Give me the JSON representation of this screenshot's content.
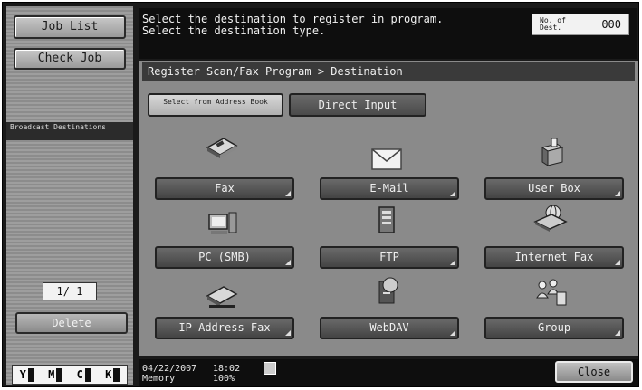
{
  "left_panel": {
    "job_list_label": "Job List",
    "check_job_label": "Check Job",
    "broadcast_label": "Broadcast Destinations",
    "page_indicator": "1/  1",
    "delete_label": "Delete",
    "toner": [
      {
        "letter": "Y"
      },
      {
        "letter": "M"
      },
      {
        "letter": "C"
      },
      {
        "letter": "K"
      }
    ]
  },
  "header": {
    "message_line1": "Select the destination to register in program.",
    "message_line2": "Select the destination type.",
    "dest_count_label": "No. of Dest.",
    "dest_count_value": "000"
  },
  "main": {
    "breadcrumb": "Register Scan/Fax Program > Destination",
    "tabs": [
      {
        "label": "Select from Address Book"
      },
      {
        "label": "Direct Input"
      }
    ],
    "destinations": [
      {
        "label": "Fax",
        "icon": "fax-icon"
      },
      {
        "label": "E-Mail",
        "icon": "email-icon"
      },
      {
        "label": "User Box",
        "icon": "user-box-icon"
      },
      {
        "label": "PC (SMB)",
        "icon": "pc-icon"
      },
      {
        "label": "FTP",
        "icon": "ftp-server-icon"
      },
      {
        "label": "Internet Fax",
        "icon": "internet-fax-icon"
      },
      {
        "label": "IP Address Fax",
        "icon": "ip-fax-icon"
      },
      {
        "label": "WebDAV",
        "icon": "webdav-icon"
      },
      {
        "label": "Group",
        "icon": "group-icon"
      }
    ]
  },
  "status": {
    "date": "04/22/2007",
    "time": "18:02",
    "memory_label": "Memory",
    "memory_value": "100%",
    "close_label": "Close"
  }
}
